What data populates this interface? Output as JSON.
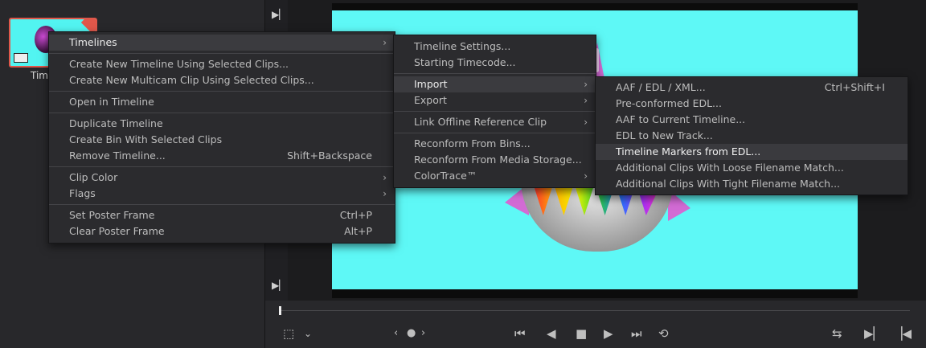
{
  "media_pool": {
    "clip_label": "Time"
  },
  "menu": {
    "header": {
      "label": "Timelines",
      "arrow": "›"
    },
    "groups": [
      [
        {
          "label": "Create New Timeline Using Selected Clips..."
        },
        {
          "label": "Create New Multicam Clip Using Selected Clips..."
        }
      ],
      [
        {
          "label": "Open in Timeline"
        }
      ],
      [
        {
          "label": "Duplicate Timeline"
        },
        {
          "label": "Create Bin With Selected Clips"
        },
        {
          "label": "Remove Timeline...",
          "shortcut": "Shift+Backspace"
        }
      ],
      [
        {
          "label": "Clip Color",
          "submenu": true
        },
        {
          "label": "Flags",
          "submenu": true
        }
      ],
      [
        {
          "label": "Set Poster Frame",
          "shortcut": "Ctrl+P"
        },
        {
          "label": "Clear Poster Frame",
          "shortcut": "Alt+P"
        }
      ]
    ]
  },
  "timelines_submenu": {
    "items": [
      {
        "label": "Timeline Settings..."
      },
      {
        "label": "Starting Timecode..."
      },
      {
        "sep": true
      },
      {
        "label": "Import",
        "submenu": true,
        "active": true
      },
      {
        "label": "Export",
        "submenu": true
      },
      {
        "sep": true
      },
      {
        "label": "Link Offline Reference Clip",
        "submenu": true
      },
      {
        "sep": true
      },
      {
        "label": "Reconform From Bins..."
      },
      {
        "label": "Reconform From Media Storage..."
      },
      {
        "label": "ColorTrace™",
        "submenu": true
      }
    ]
  },
  "import_submenu": {
    "items": [
      {
        "label": "AAF / EDL / XML...",
        "shortcut": "Ctrl+Shift+I"
      },
      {
        "label": "Pre-conformed EDL..."
      },
      {
        "label": "AAF to Current Timeline..."
      },
      {
        "label": "EDL to New Track..."
      },
      {
        "label": "Timeline Markers from EDL...",
        "hover": true
      },
      {
        "label": "Additional Clips With Loose Filename Match..."
      },
      {
        "label": "Additional Clips With Tight Filename Match..."
      }
    ]
  },
  "transport": {
    "icons": [
      "transform-icon",
      "chevron-down-icon",
      "prev-clip-icon",
      "dot-icon",
      "next-clip-icon",
      "jump-start-icon",
      "play-reverse-icon",
      "stop-icon",
      "play-icon",
      "jump-end-icon",
      "loop-icon",
      "match-frame-icon",
      "next-frame-icon",
      "prev-frame-icon"
    ]
  },
  "colors": {
    "accent_red": "#e0574a",
    "viewer_bg": "#5ef8f6",
    "menu_bg": "#2b2b2e"
  }
}
